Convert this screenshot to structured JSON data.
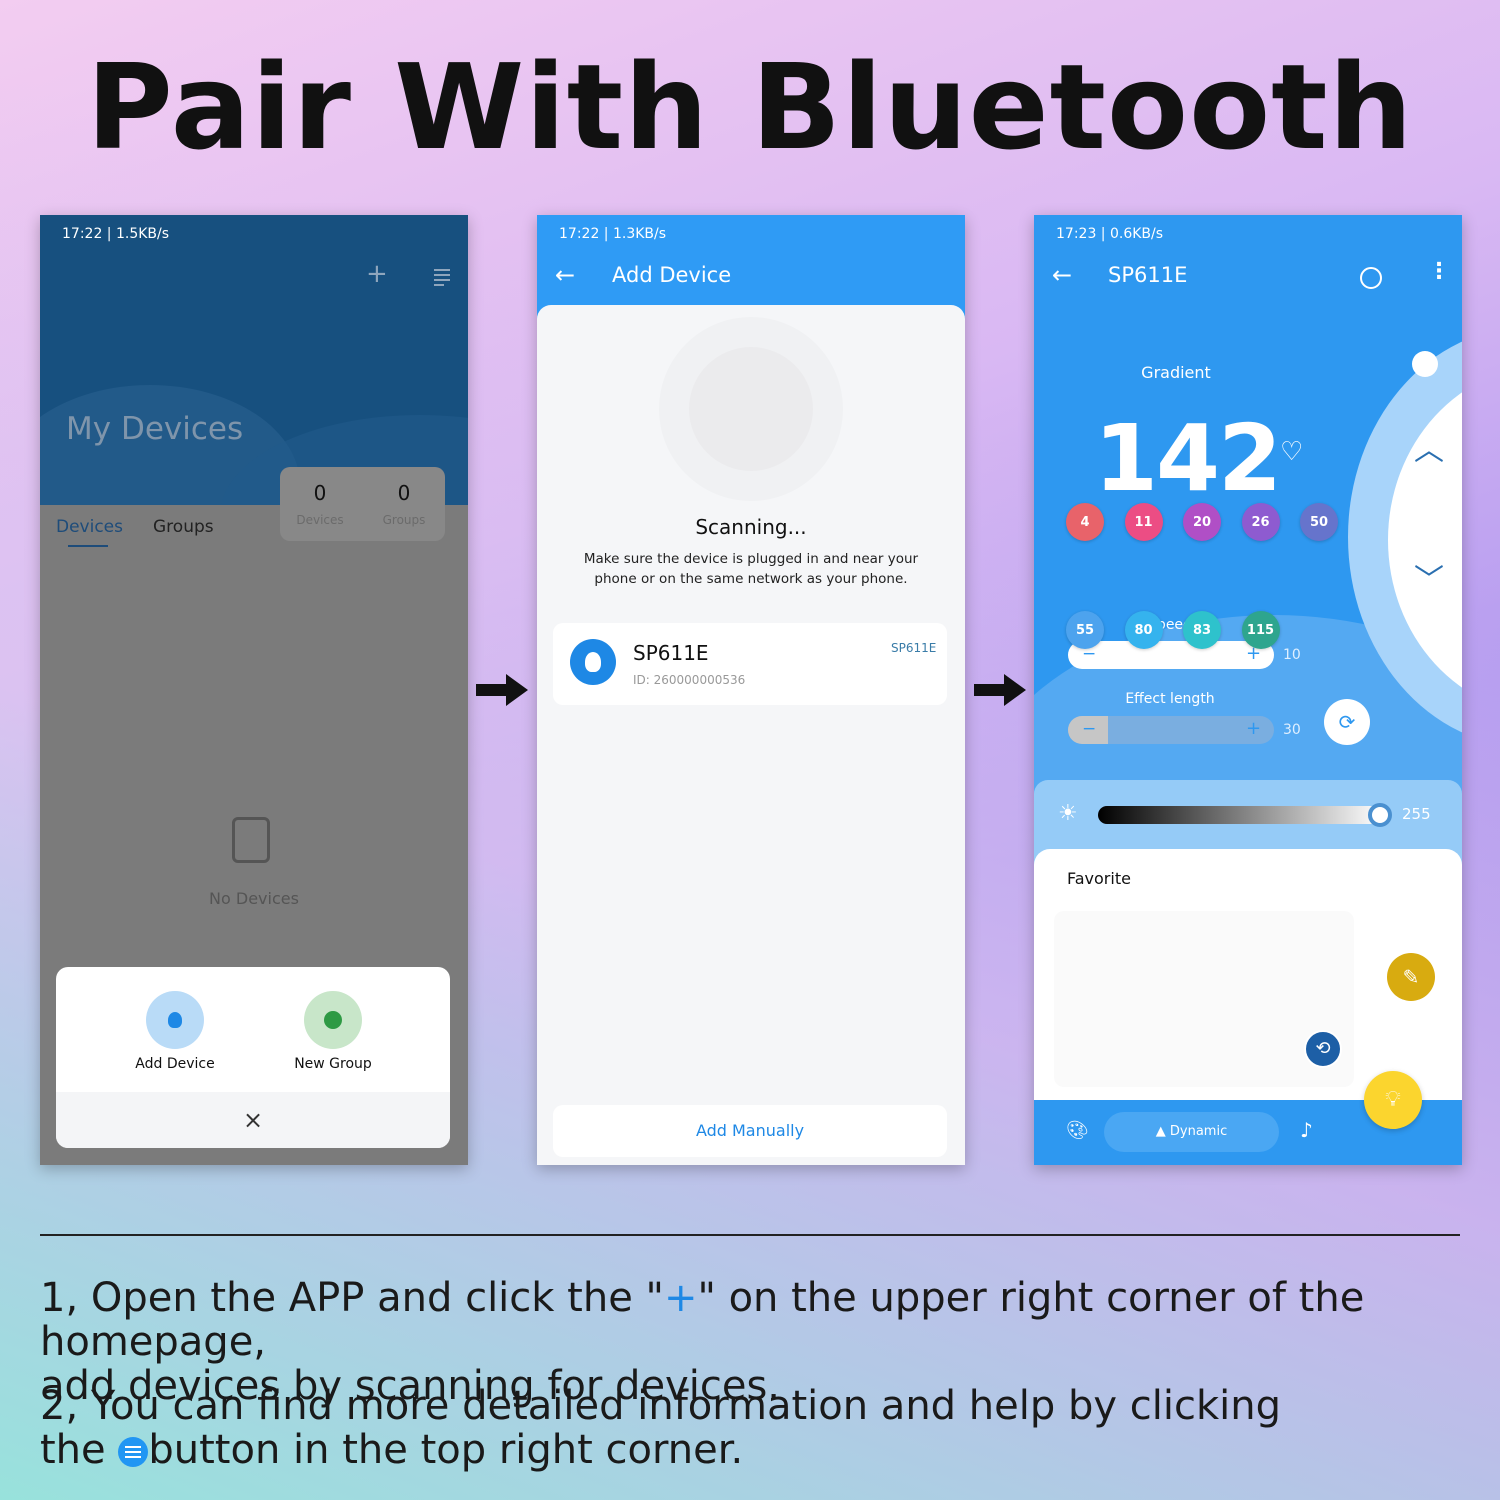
{
  "title": "Pair With Bluetooth",
  "phone1": {
    "status": "17:22 | 1.5KB/s",
    "heading": "My Devices",
    "tabs": [
      "Devices",
      "Groups"
    ],
    "stats": [
      {
        "value": "0",
        "label": "Devices"
      },
      {
        "value": "0",
        "label": "Groups"
      }
    ],
    "empty": "No Devices",
    "sheet": {
      "add_device": "Add Device",
      "new_group": "New Group"
    }
  },
  "phone2": {
    "status": "17:22 | 1.3KB/s",
    "header": "Add Device",
    "scanning": "Scanning...",
    "hint": "Make sure the device is plugged in and near your phone or on the same network as your phone.",
    "device": {
      "name": "SP611E",
      "id": "ID: 260000000536",
      "tag": "SP611E"
    },
    "add_manually": "Add Manually"
  },
  "phone3": {
    "status": "17:23 | 0.6KB/s",
    "header": "SP611E",
    "mode": "Gradient",
    "number": "142",
    "speed_label": "Speed",
    "speed_value": "10",
    "length_label": "Effect length",
    "length_value": "30",
    "brightness": "255",
    "favorite": "Favorite",
    "favorites": [
      {
        "v": "4",
        "c": "#e8636a"
      },
      {
        "v": "11",
        "c": "#ec4d84"
      },
      {
        "v": "20",
        "c": "#b04fc6"
      },
      {
        "v": "26",
        "c": "#8e5bd0"
      },
      {
        "v": "50",
        "c": "#6674cc"
      },
      {
        "v": "55",
        "c": "#4da3ee"
      },
      {
        "v": "80",
        "c": "#35b3ee"
      },
      {
        "v": "83",
        "c": "#2ec2cc"
      },
      {
        "v": "115",
        "c": "#2ea58e"
      }
    ],
    "nav_dynamic": "Dynamic"
  },
  "instructions": {
    "p1_a": "1, Open the APP and click the \"",
    "p1_plus": "+",
    "p1_b": "\" on the upper right corner of the homepage,",
    "p1_c": "add devices by scanning for devices.",
    "p2_a": "2, You can find more detailed information and help by clicking",
    "p2_b": "the",
    "p2_c": "button in the top right corner."
  },
  "colors": {
    "accent": "#2e98f0",
    "plus": "#1e88e5"
  }
}
